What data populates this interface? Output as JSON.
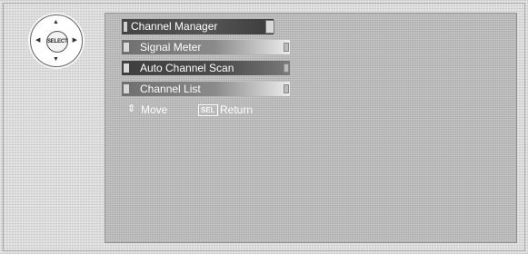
{
  "remote": {
    "center_label": "SELECT",
    "up_glyph": "▲",
    "down_glyph": "▼",
    "left_glyph": "◀",
    "right_glyph": "▶"
  },
  "menu": {
    "title": "Channel Manager",
    "items": [
      {
        "label": "Signal Meter",
        "selected": false
      },
      {
        "label": "Auto Channel Scan",
        "selected": true
      },
      {
        "label": "Channel List",
        "selected": false
      }
    ]
  },
  "help_bar": {
    "updown_glyph": "⇕",
    "move_label": "Move",
    "sel_key": "SEL",
    "return_label": "Return"
  }
}
